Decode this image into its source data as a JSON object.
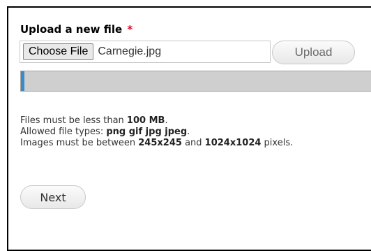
{
  "form": {
    "label": "Upload a new file",
    "required_marker": "*",
    "choose_file_label": "Choose File",
    "file_name": "Carnegie.jpg",
    "upload_label": "Upload",
    "progress_fraction": 0.01,
    "help": {
      "size_prefix": "Files must be less than ",
      "size_value": "100 MB",
      "size_suffix": ".",
      "types_prefix": "Allowed file types: ",
      "types_value": "png gif jpg jpeg",
      "types_suffix": ".",
      "dims_prefix": "Images must be between ",
      "dims_min": "245x245",
      "dims_and": " and ",
      "dims_max": "1024x1024",
      "dims_suffix": " pixels."
    },
    "next_label": "Next"
  },
  "colors": {
    "required": "#e2001a",
    "progress_fill": "#3a8bc8",
    "progress_track": "#cfcfcf"
  }
}
